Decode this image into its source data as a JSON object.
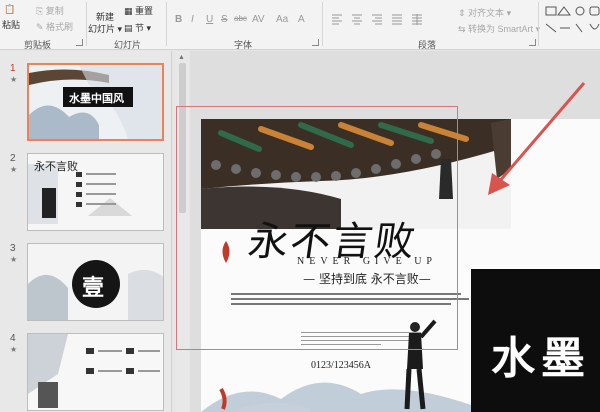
{
  "ribbon": {
    "clipboard": {
      "paste": "粘贴",
      "copy": "复制",
      "format_painter": "格式刷",
      "group": "剪贴板"
    },
    "slides": {
      "new_slide_line1": "新建",
      "new_slide_line2": "幻灯片",
      "reset": "重置",
      "section": "节",
      "group": "幻灯片"
    },
    "font": {
      "group": "字体",
      "buttons": [
        "B",
        "I",
        "U",
        "S",
        "abc",
        "AV",
        "Aa",
        "A"
      ]
    },
    "paragraph": {
      "group": "段落",
      "align_text": "对齐文本",
      "convert_smartart": "转换为 SmartArt"
    }
  },
  "thumbnails": [
    {
      "number": "1",
      "title": "水墨中国风",
      "selected": true
    },
    {
      "number": "2",
      "title": "永不言败",
      "selected": false
    },
    {
      "number": "3",
      "title": "壹",
      "selected": false
    },
    {
      "number": "4",
      "title": "",
      "selected": false
    }
  ],
  "slide": {
    "calligraphy": "永不言败",
    "never_give_up": "NEVER GIVE UP",
    "slogan": "— 坚持到底 永不言败—",
    "phone": "0123/123456A",
    "title_fragment": "水墨"
  },
  "colors": {
    "accent": "#c43b1d",
    "selection": "#e8845c",
    "arrow": "#d9534f"
  }
}
